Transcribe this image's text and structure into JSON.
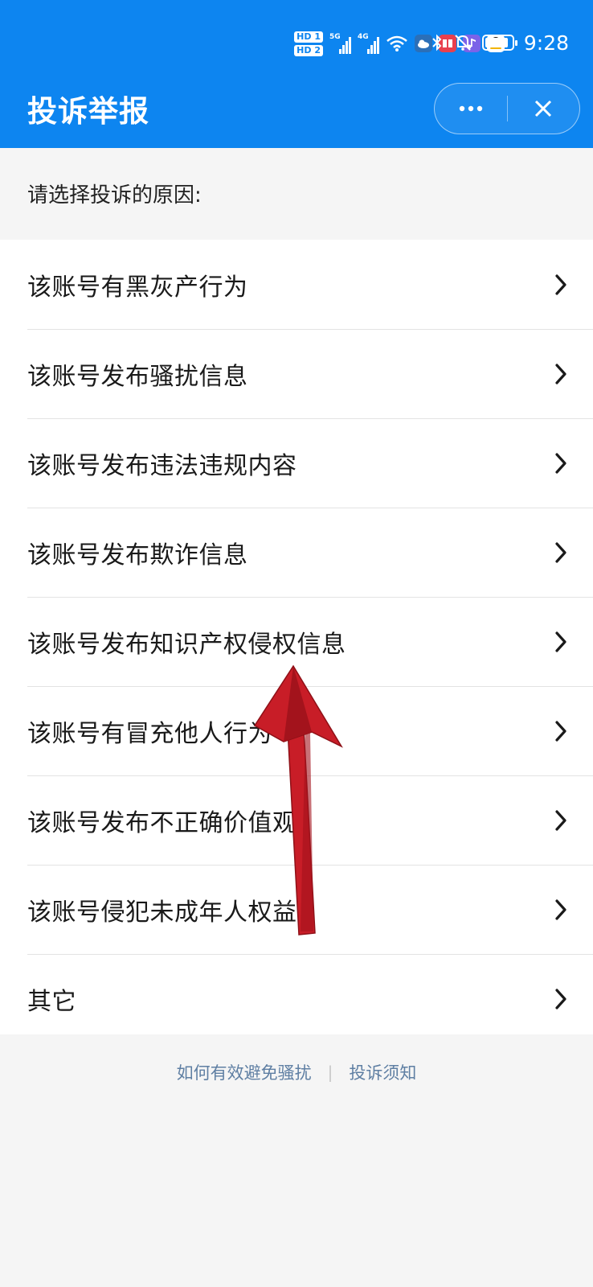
{
  "status_bar": {
    "time": "9:28",
    "hd_badges": [
      "HD 1",
      "HD 2"
    ],
    "network_labels": [
      "5G",
      "4G"
    ],
    "icons": [
      "signal-5g-icon",
      "signal-4g-icon",
      "wifi-icon",
      "weather-app-icon",
      "reader-app-icon",
      "music-app-icon",
      "qq-app-icon",
      "bluetooth-icon",
      "mute-icon",
      "battery-icon"
    ]
  },
  "header": {
    "title": "投诉举报",
    "background": "#0d85f0",
    "more_icon": "more-dots-icon",
    "close_icon": "close-icon"
  },
  "prompt": "请选择投诉的原因:",
  "reasons": [
    {
      "label": "该账号有黑灰产行为"
    },
    {
      "label": "该账号发布骚扰信息"
    },
    {
      "label": "该账号发布违法违规内容"
    },
    {
      "label": "该账号发布欺诈信息"
    },
    {
      "label": "该账号发布知识产权侵权信息"
    },
    {
      "label": "该账号有冒充他人行为"
    },
    {
      "label": "该账号发布不正确价值观"
    },
    {
      "label": "该账号侵犯未成年人权益"
    },
    {
      "label": "其它"
    }
  ],
  "footer": {
    "link_avoid": "如何有效避免骚扰",
    "link_notice": "投诉须知"
  },
  "annotation": {
    "type": "arrow",
    "color": "#d01f2b",
    "points_to": "该账号发布知识产权侵权信息"
  }
}
